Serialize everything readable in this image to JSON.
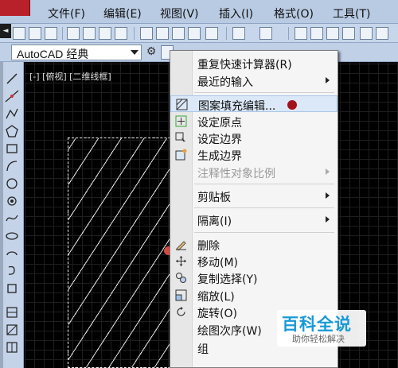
{
  "menubar": {
    "items": [
      "文件(F)",
      "编辑(E)",
      "视图(V)",
      "插入(I)",
      "格式(O)",
      "工具(T)"
    ]
  },
  "workspace": {
    "selected": "AutoCAD 经典"
  },
  "viewport": {
    "label": "[-] [俯视] [二维线框]"
  },
  "context_menu": {
    "items": [
      {
        "label": "重复快速计算器(R)",
        "icon": "",
        "submenu": false,
        "disabled": false
      },
      {
        "label": "最近的输入",
        "icon": "",
        "submenu": true,
        "disabled": false
      },
      {
        "label": "图案填充编辑...",
        "icon": "hatch-edit-icon",
        "submenu": false,
        "disabled": false,
        "highlighted": true
      },
      {
        "label": "设定原点",
        "icon": "set-origin-icon",
        "submenu": false,
        "disabled": false
      },
      {
        "label": "设定边界",
        "icon": "set-boundary-icon",
        "submenu": false,
        "disabled": false
      },
      {
        "label": "生成边界",
        "icon": "generate-boundary-icon",
        "submenu": false,
        "disabled": false
      },
      {
        "label": "注释性对象比例",
        "icon": "",
        "submenu": true,
        "disabled": true
      },
      {
        "label": "剪贴板",
        "icon": "",
        "submenu": true,
        "disabled": false
      },
      {
        "label": "隔离(I)",
        "icon": "",
        "submenu": true,
        "disabled": false
      },
      {
        "label": "删除",
        "icon": "erase-icon",
        "submenu": false,
        "disabled": false
      },
      {
        "label": "移动(M)",
        "icon": "move-icon",
        "submenu": false,
        "disabled": false
      },
      {
        "label": "复制选择(Y)",
        "icon": "copy-icon",
        "submenu": false,
        "disabled": false
      },
      {
        "label": "缩放(L)",
        "icon": "scale-icon",
        "submenu": false,
        "disabled": false
      },
      {
        "label": "旋转(O)",
        "icon": "rotate-icon",
        "submenu": false,
        "disabled": false
      },
      {
        "label": "绘图次序(W)",
        "icon": "",
        "submenu": true,
        "disabled": false
      },
      {
        "label": "组",
        "icon": "",
        "submenu": false,
        "disabled": false
      }
    ]
  },
  "watermark": {
    "title": "百科全说",
    "subtitle": "助你轻松解决"
  },
  "colors": {
    "hatch_marker": "#a3121a",
    "watermark_blue": "#179ad6"
  }
}
